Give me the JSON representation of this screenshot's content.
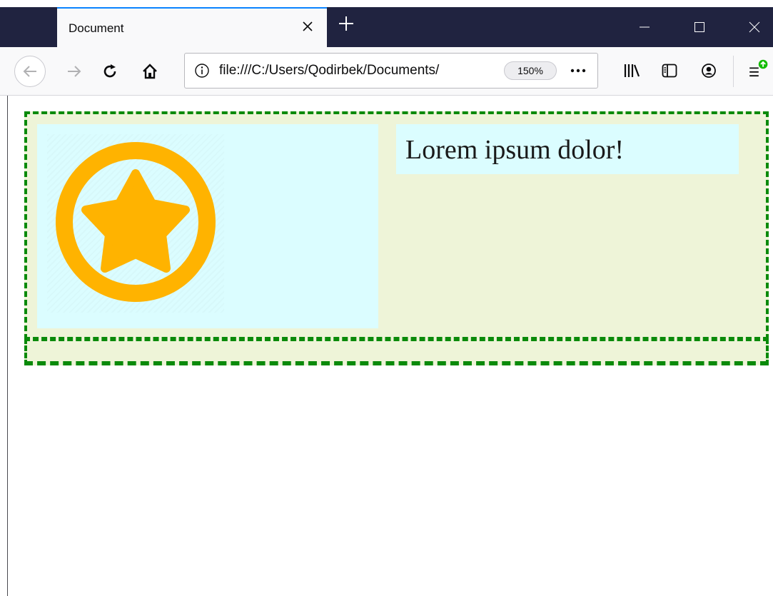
{
  "tab": {
    "title": "Document"
  },
  "url": {
    "text": "file:///C:/Users/Qodirbek/Documents/",
    "zoom": "150%"
  },
  "page": {
    "heading": "Lorem ipsum dolor!"
  },
  "icons": {
    "tab_close": "close-icon",
    "new_tab": "plus-icon",
    "back": "arrow-left-icon",
    "forward": "arrow-right-icon",
    "reload": "reload-icon",
    "home": "home-icon",
    "info": "info-icon",
    "more": "ellipsis-icon",
    "library": "library-icon",
    "sidebar": "sidebar-icon",
    "account": "account-icon",
    "menu": "hamburger-menu-icon",
    "image": "star-badge-icon"
  },
  "colors": {
    "titlebar": "#202340",
    "accent": "#0a84ff",
    "dashed_border": "#0a8a0a",
    "box_background": "#eef4d8",
    "cell_background": "#dbfdff",
    "badge": "#ffb300",
    "update_badge": "#12bc00"
  }
}
